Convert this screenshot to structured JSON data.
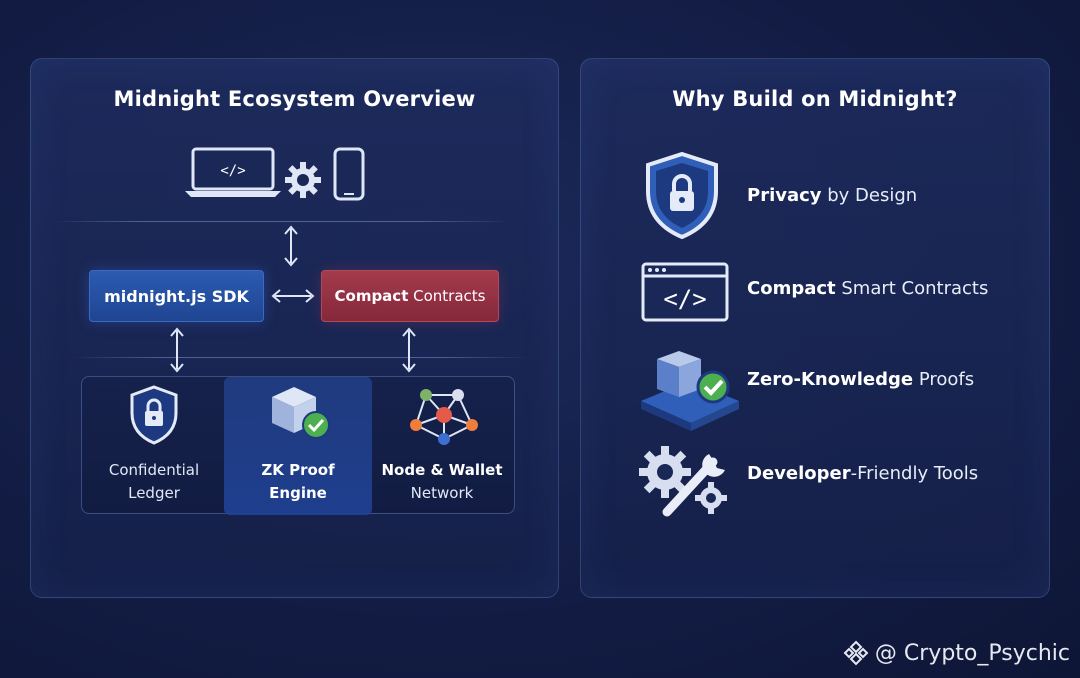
{
  "left_panel": {
    "title": "Midnight Ecosystem Overview",
    "top_icons": [
      "laptop-code-icon",
      "gear-icon",
      "smartphone-icon"
    ],
    "laptop_code_glyph": "</>",
    "sdk_box": {
      "label": "midnight.js SDK"
    },
    "compact_box": {
      "label_bold": "Compact",
      "label_rest": " Contracts"
    },
    "tray": {
      "ledger": {
        "line1": "Confidential",
        "line2": "Ledger",
        "icon": "shield-lock-icon"
      },
      "zk": {
        "line1": "ZK Proof",
        "line2": "Engine",
        "icon": "cube-check-icon"
      },
      "node": {
        "line1": "Node & Wallet",
        "line2": "Network",
        "icon": "network-nodes-icon"
      }
    }
  },
  "right_panel": {
    "title": "Why Build on Midnight?",
    "features": [
      {
        "bold": "Privacy",
        "rest": " by Design",
        "icon": "shield-lock-icon"
      },
      {
        "bold": "Compact",
        "rest": " Smart Contracts",
        "icon": "code-window-icon"
      },
      {
        "bold": "Zero-Knowledge",
        "rest": " Proofs",
        "icon": "cube-check-icon"
      },
      {
        "bold": "Developer",
        "rest": "-Friendly Tools",
        "icon": "gear-wrench-icon"
      }
    ],
    "code_window_glyph": "</>"
  },
  "watermark": {
    "text": "@ Crypto_Psychic",
    "icon": "binance-logo-icon"
  },
  "colors": {
    "background": "#131d45",
    "sdk_blue": "#2c5bb1",
    "compact_red": "#a33b4c",
    "accent_green": "#4caf50",
    "shield_blue": "#2f5fb8"
  }
}
